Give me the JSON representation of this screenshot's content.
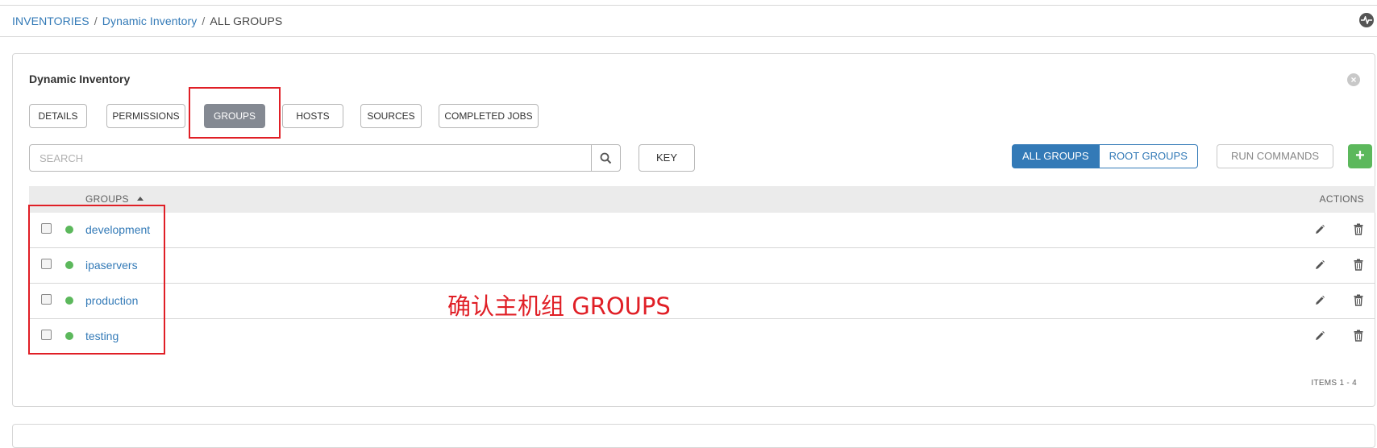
{
  "breadcrumb": {
    "inventories": "INVENTORIES",
    "sep1": "/",
    "inventory": "Dynamic Inventory",
    "sep2": "/",
    "current": "ALL GROUPS"
  },
  "panel": {
    "title": "Dynamic Inventory",
    "close_glyph": "×"
  },
  "tabs": [
    {
      "label": "DETAILS"
    },
    {
      "label": "PERMISSIONS"
    },
    {
      "label": "GROUPS",
      "active": true
    },
    {
      "label": "HOSTS"
    },
    {
      "label": "SOURCES"
    },
    {
      "label": "COMPLETED JOBS"
    }
  ],
  "search": {
    "placeholder": "SEARCH",
    "key_label": "KEY"
  },
  "toggle": {
    "all_groups": "ALL GROUPS",
    "root_groups": "ROOT GROUPS"
  },
  "actions": {
    "run_commands": "RUN COMMANDS",
    "add": "+"
  },
  "table": {
    "col_groups": "GROUPS",
    "col_actions": "ACTIONS",
    "rows": [
      {
        "name": "development",
        "status_color": "#5cb85c"
      },
      {
        "name": "ipaservers",
        "status_color": "#5cb85c"
      },
      {
        "name": "production",
        "status_color": "#5cb85c"
      },
      {
        "name": "testing",
        "status_color": "#5cb85c"
      }
    ]
  },
  "annotation": "确认主机组 GROUPS",
  "pagination": "ITEMS  1 - 4",
  "colors": {
    "link": "#337ab7",
    "active_tab": "#848992",
    "add": "#5cb85c",
    "highlight": "#e01f26"
  }
}
